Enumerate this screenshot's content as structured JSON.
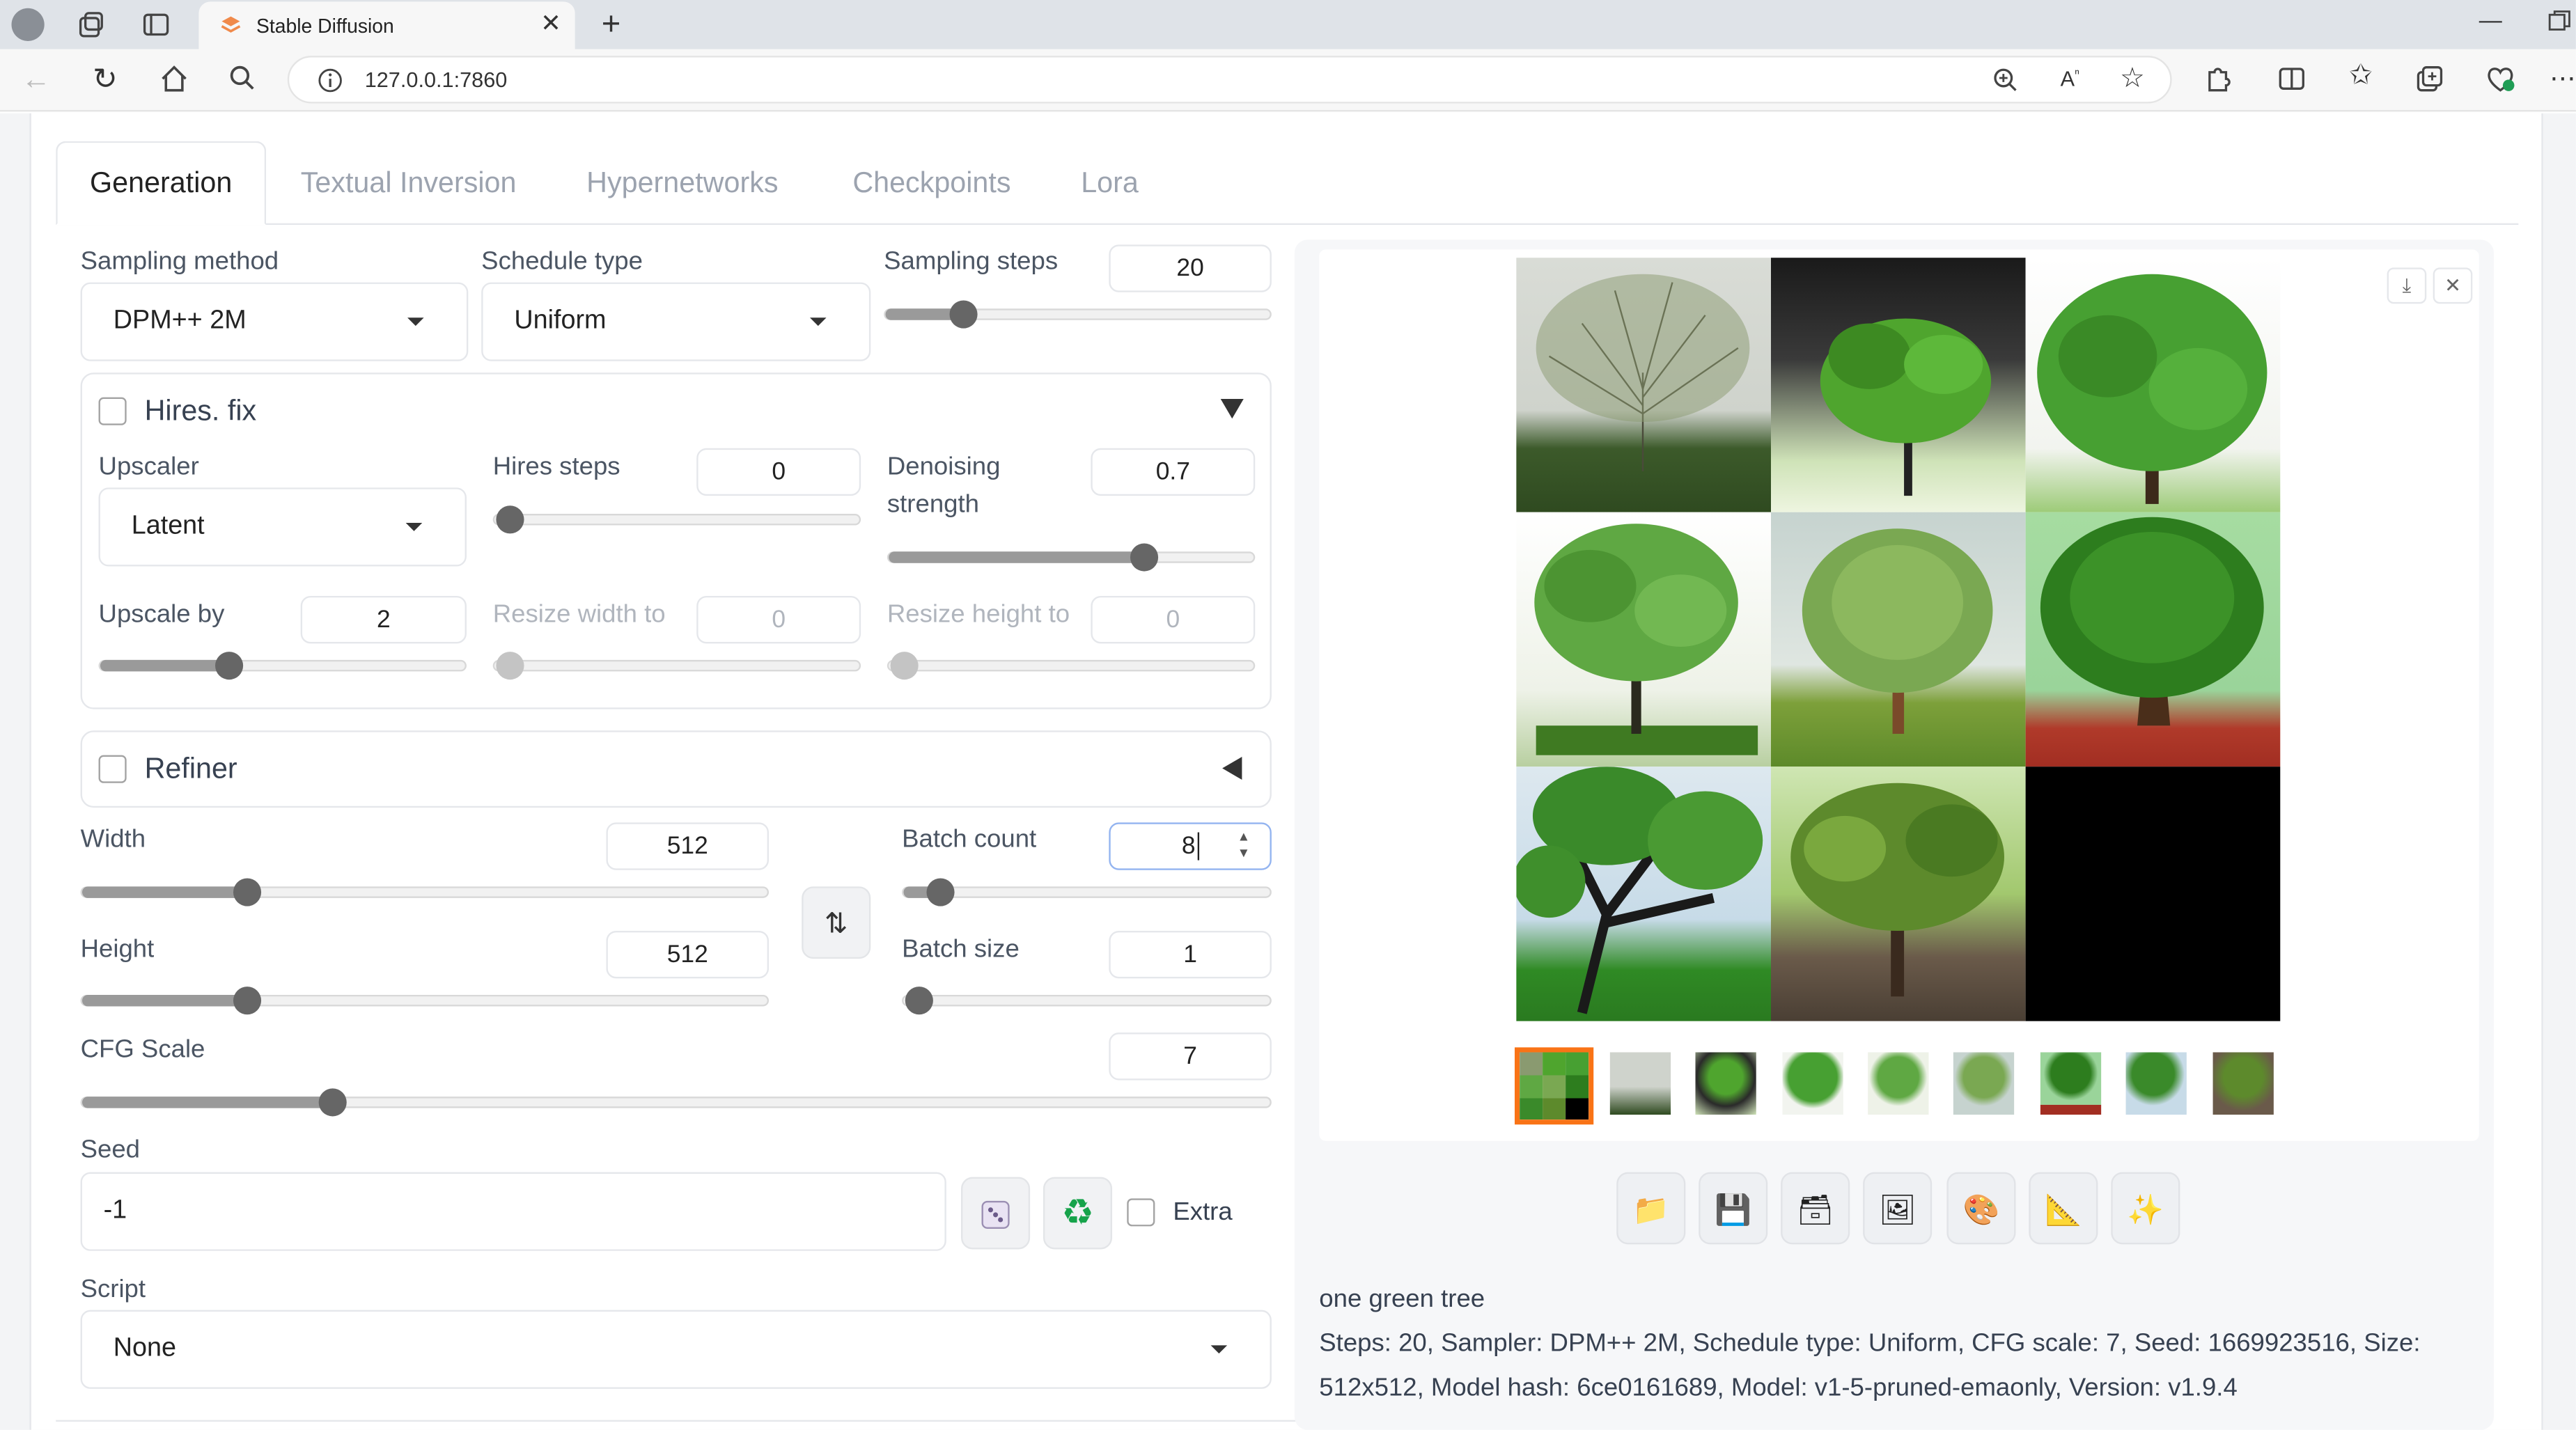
{
  "browser": {
    "tab_title": "Stable Diffusion",
    "url": "127.0.0.1:7860"
  },
  "tabs": [
    "Generation",
    "Textual Inversion",
    "Hypernetworks",
    "Checkpoints",
    "Lora"
  ],
  "generation": {
    "sampling_method": {
      "label": "Sampling method",
      "value": "DPM++ 2M"
    },
    "schedule_type": {
      "label": "Schedule type",
      "value": "Uniform"
    },
    "sampling_steps": {
      "label": "Sampling steps",
      "value": "20",
      "fraction": 0.2
    },
    "hires": {
      "title": "Hires. fix",
      "upscaler": {
        "label": "Upscaler",
        "value": "Latent"
      },
      "hires_steps": {
        "label": "Hires steps",
        "value": "0",
        "fraction": 0.0
      },
      "denoising": {
        "label1": "Denoising",
        "label2": "strength",
        "value": "0.7",
        "fraction": 0.7
      },
      "upscale_by": {
        "label": "Upscale by",
        "value": "2",
        "fraction": 0.35
      },
      "resize_width": {
        "label": "Resize width to",
        "value": "0",
        "fraction": 0.0
      },
      "resize_height": {
        "label": "Resize height to",
        "value": "0",
        "fraction": 0.0
      }
    },
    "refiner": {
      "title": "Refiner"
    },
    "width": {
      "label": "Width",
      "value": "512",
      "fraction": 0.24
    },
    "height": {
      "label": "Height",
      "value": "512",
      "fraction": 0.24
    },
    "batch_count": {
      "label": "Batch count",
      "value": "8",
      "fraction": 0.1
    },
    "batch_size": {
      "label": "Batch size",
      "value": "1",
      "fraction": 0.0
    },
    "cfg_scale": {
      "label": "CFG Scale",
      "value": "7",
      "fraction": 0.21
    },
    "seed": {
      "label": "Seed",
      "value": "-1",
      "extra_label": "Extra"
    },
    "script": {
      "label": "Script",
      "value": "None"
    }
  },
  "output": {
    "prompt": "one green tree",
    "info_line1": "Steps: 20, Sampler: DPM++ 2M, Schedule type: Uniform, CFG scale: 7, Seed: 1669923516, Size:",
    "info_line2": "512x512, Model hash: 6ce0161689, Model: v1-5-pruned-emaonly, Version: v1.9.4"
  },
  "colors": {
    "accent_orange": "#f97316",
    "slider_thumb": "#666666"
  },
  "icons": [
    "profile-icon",
    "workspaces-icon",
    "tab-actions-icon",
    "back-icon",
    "refresh-icon",
    "home-icon",
    "search-icon",
    "info-icon",
    "zoom-icon",
    "read-aloud-icon",
    "favorite-icon",
    "extensions-icon",
    "split-screen-icon",
    "favorites-icon",
    "collections-icon",
    "browser-essentials-icon",
    "more-icon",
    "swap-icon",
    "dice-icon",
    "recycle-icon",
    "folder-icon",
    "save-icon",
    "zip-icon",
    "image-icon",
    "palette-icon",
    "ruler-icon",
    "sparkle-icon",
    "download-icon",
    "close-icon"
  ]
}
